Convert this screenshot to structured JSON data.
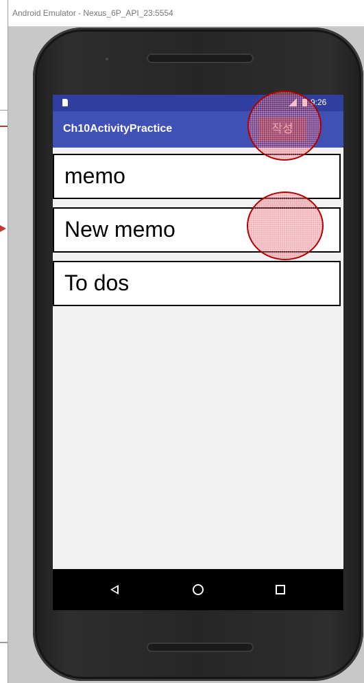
{
  "window": {
    "title": "Android Emulator - Nexus_6P_API_23:5554"
  },
  "status_bar": {
    "time": "9:26",
    "icons": [
      "sd-card-icon",
      "signal-icon",
      "battery-icon"
    ]
  },
  "app_bar": {
    "title": "Ch10ActivityPractice",
    "write_button_label": "작성"
  },
  "memo_list": {
    "items": [
      {
        "label": "memo"
      },
      {
        "label": "New memo"
      },
      {
        "label": "To dos"
      }
    ]
  },
  "nav_bar": {
    "icons": [
      "back-icon",
      "home-icon",
      "recents-icon"
    ]
  },
  "colors": {
    "status_bar": "#303F9F",
    "app_bar": "#3F51B5",
    "annotation": "#DC283C"
  }
}
